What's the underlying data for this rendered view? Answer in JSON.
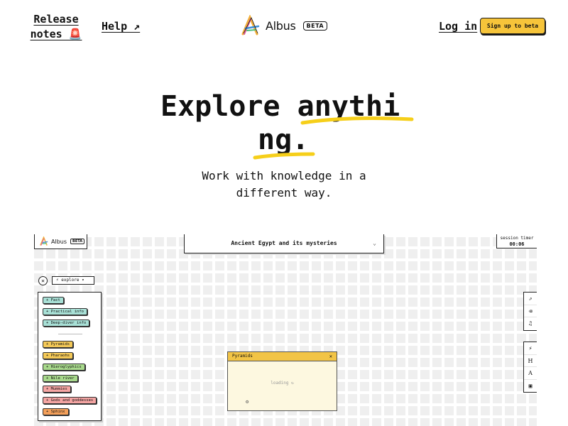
{
  "nav": {
    "release_notes": "Release notes 🚨",
    "help": "Help ↗",
    "login": "Log in",
    "signup": "Sign up to beta",
    "brand": "Albus",
    "beta": "BETA"
  },
  "hero": {
    "title_line1": "Explore anythi",
    "title_line2": "ng.",
    "subtitle": "Work with knowledge in a different way."
  },
  "demo": {
    "brand": "Albus",
    "beta": "BETA",
    "search_topic": "Ancient Egypt and its mysteries",
    "timer_label": "session timer",
    "timer_value": "00:06",
    "close_symbol": "✕",
    "explore_label": "⚡ explore ▾",
    "sidebar_top": [
      {
        "label": "+ Fact",
        "color": "teal"
      },
      {
        "label": "+ Practical info",
        "color": "teal"
      },
      {
        "label": "+ Deep-diver info",
        "color": "teal"
      }
    ],
    "sidebar_topics": [
      {
        "label": "+ Pyramids",
        "color": "yellow"
      },
      {
        "label": "+ Pharaohs",
        "color": "yellow"
      },
      {
        "label": "+ Hieroglyphics",
        "color": "green"
      },
      {
        "label": "+ Nile river",
        "color": "green"
      },
      {
        "label": "+ Mummies",
        "color": "pink"
      },
      {
        "label": "+ Gods and goddesses",
        "color": "pink"
      },
      {
        "label": "+ Sphinx",
        "color": "orange"
      }
    ],
    "toolbar_top": [
      "share-icon",
      "eraser-icon",
      "music-icon"
    ],
    "toolbar_bottom": [
      "magic-wand-icon",
      "heading-icon",
      "text-icon",
      "image-icon"
    ],
    "card_title": "Pyramids",
    "card_close": "✕",
    "card_loading": "loading ↻"
  },
  "colors": {
    "accent_yellow": "#f6c43a",
    "teal": "#a8e0d6",
    "yellow": "#f3c857",
    "green": "#a8d98c",
    "pink": "#f5a5a3",
    "orange": "#f4a05a"
  }
}
